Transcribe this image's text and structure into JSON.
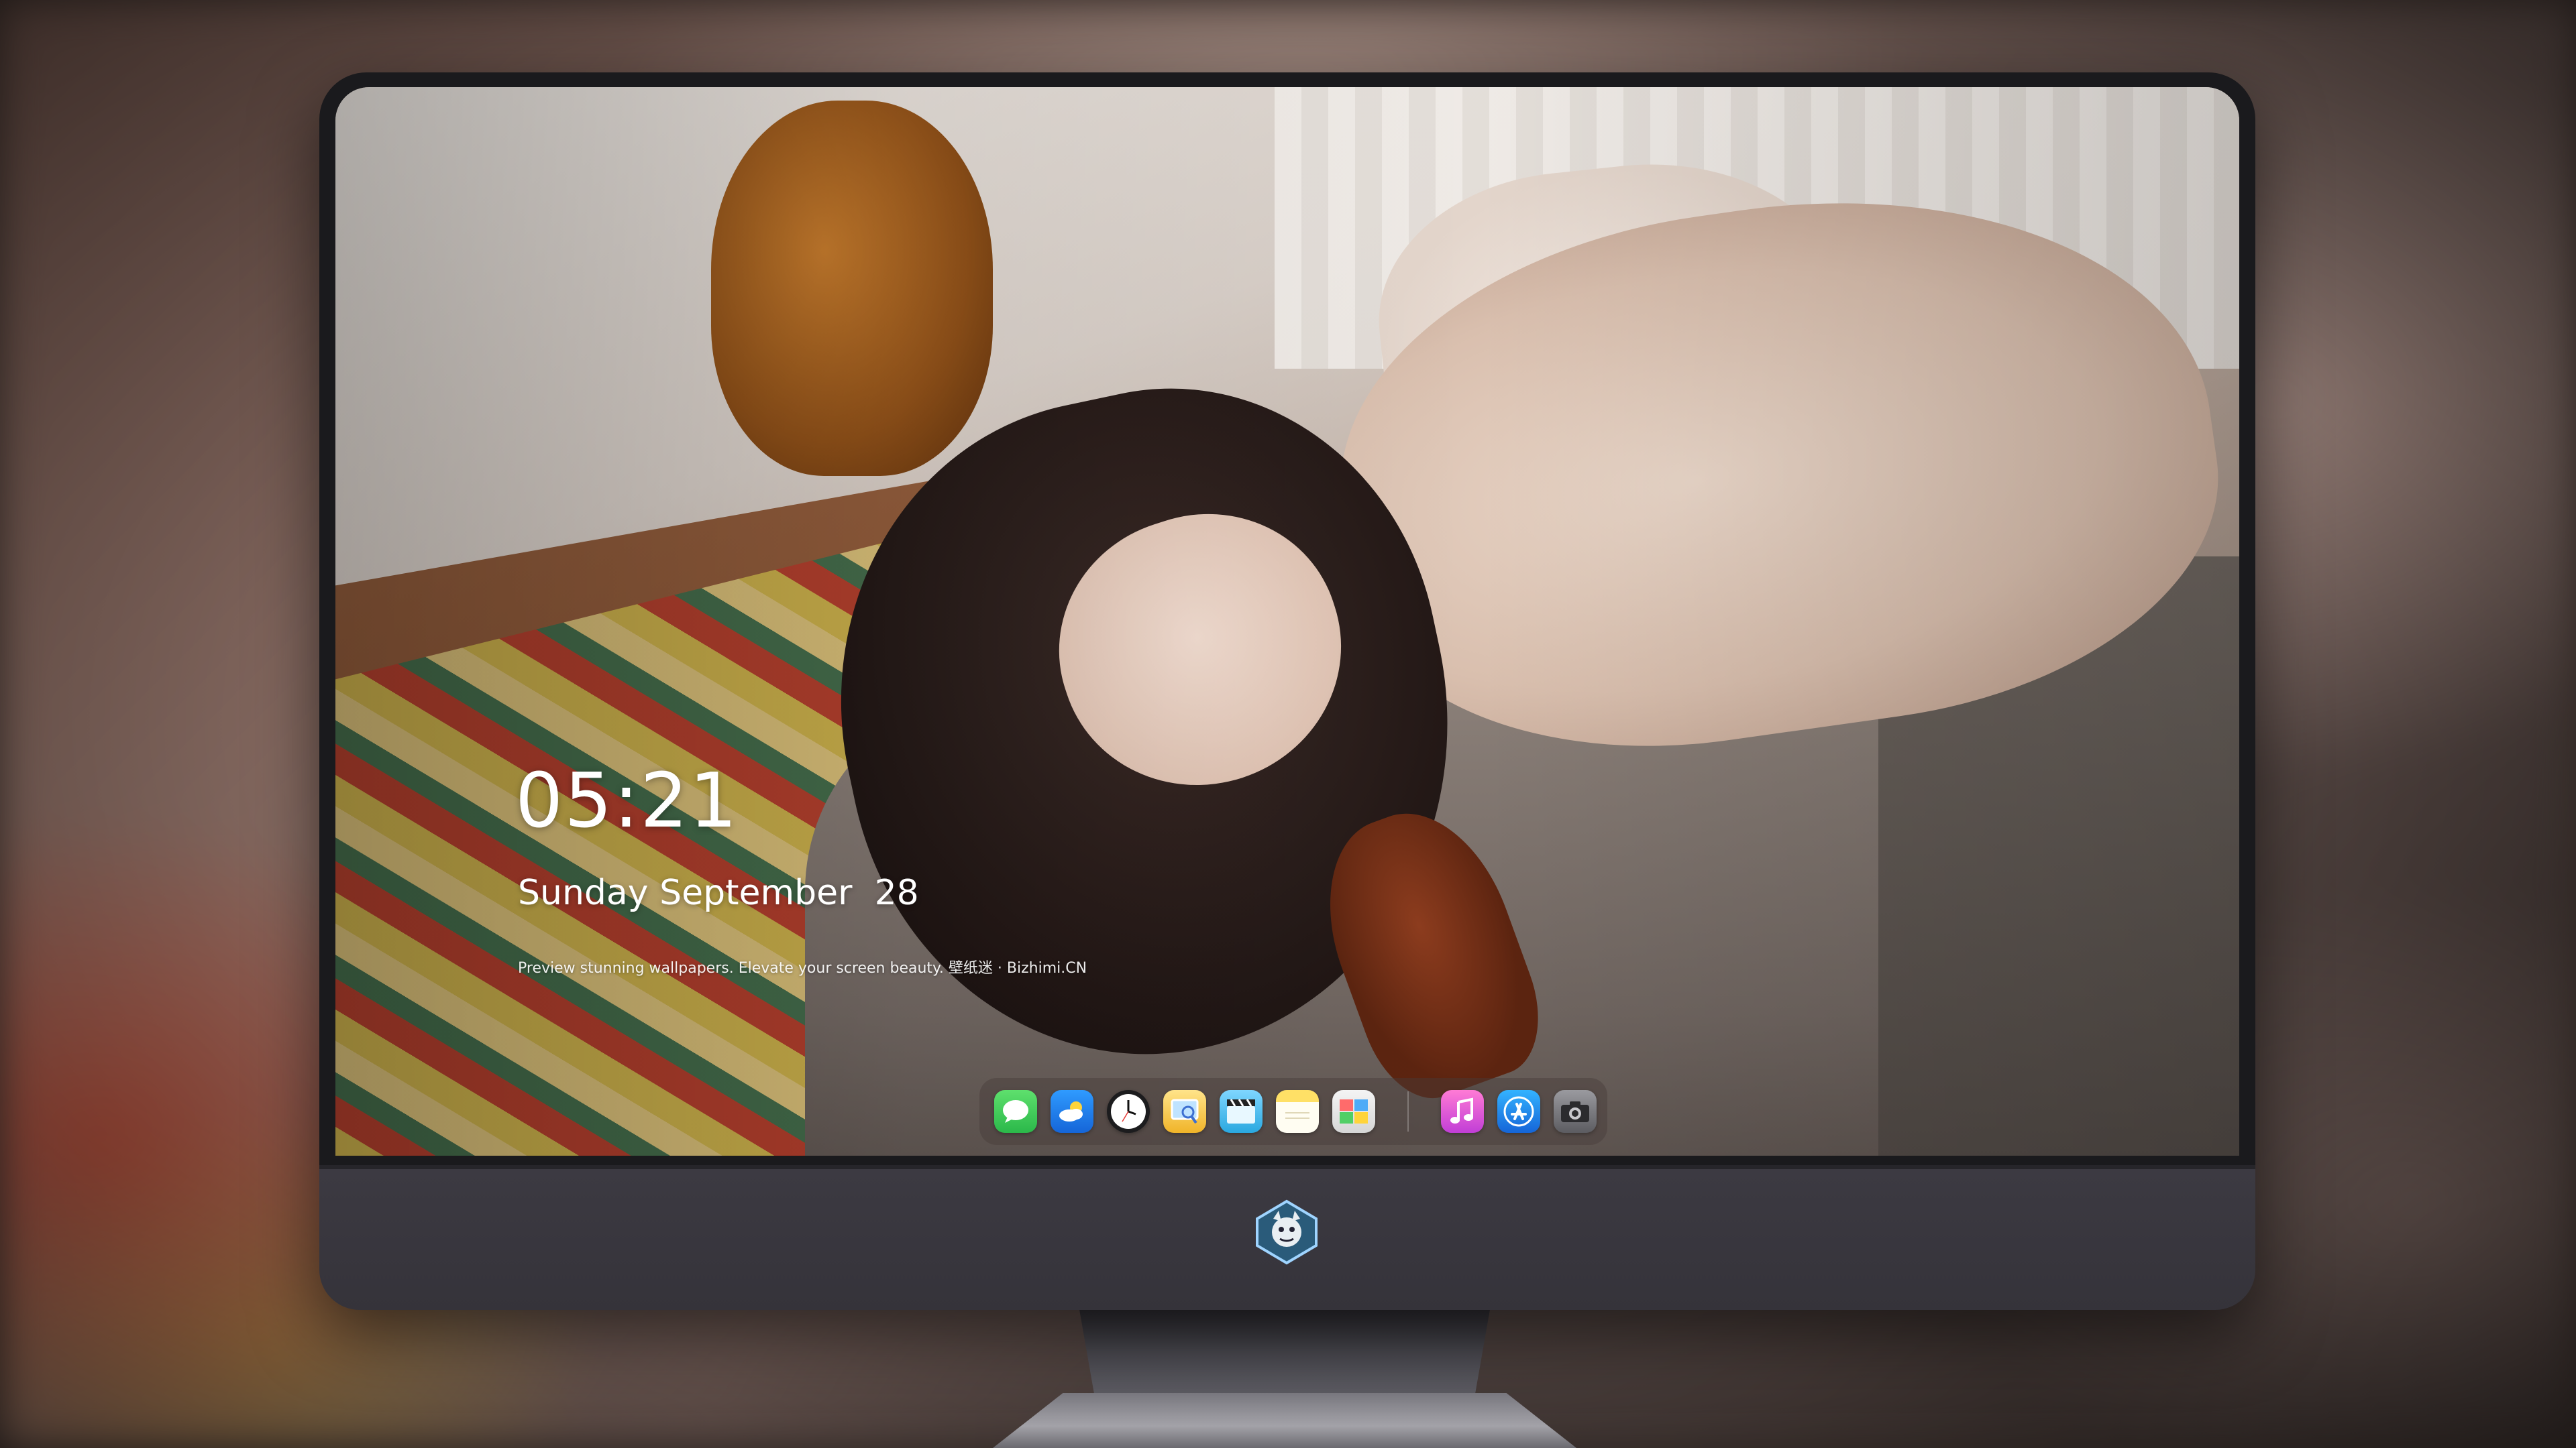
{
  "lockscreen": {
    "time": "05:21",
    "date": "Sunday September  28",
    "tagline": "Preview stunning wallpapers. Elevate your screen beauty. 壁纸迷 · Bizhimi.CN"
  },
  "dock": {
    "apps": [
      {
        "name": "messages-icon",
        "color": "#34c759"
      },
      {
        "name": "weather-icon",
        "color": "#1f8ef1"
      },
      {
        "name": "clock-icon",
        "color": "#ffffff"
      },
      {
        "name": "preview-icon",
        "color": "#f3c623"
      },
      {
        "name": "clips-icon",
        "color": "#4fc3f7"
      },
      {
        "name": "notes-icon",
        "color": "#ffd54a"
      },
      {
        "name": "photo-booth-icon",
        "color": "#e6e6e6"
      },
      {
        "name": "music-icon",
        "color": "#e84fbd"
      },
      {
        "name": "app-store-icon",
        "color": "#1e88e5"
      },
      {
        "name": "camera-icon",
        "color": "#8e8e93"
      }
    ]
  },
  "colors": {
    "monitor_bezel": "#1a1a1d",
    "monitor_chin": "#3c3a42",
    "text": "#ffffff"
  }
}
